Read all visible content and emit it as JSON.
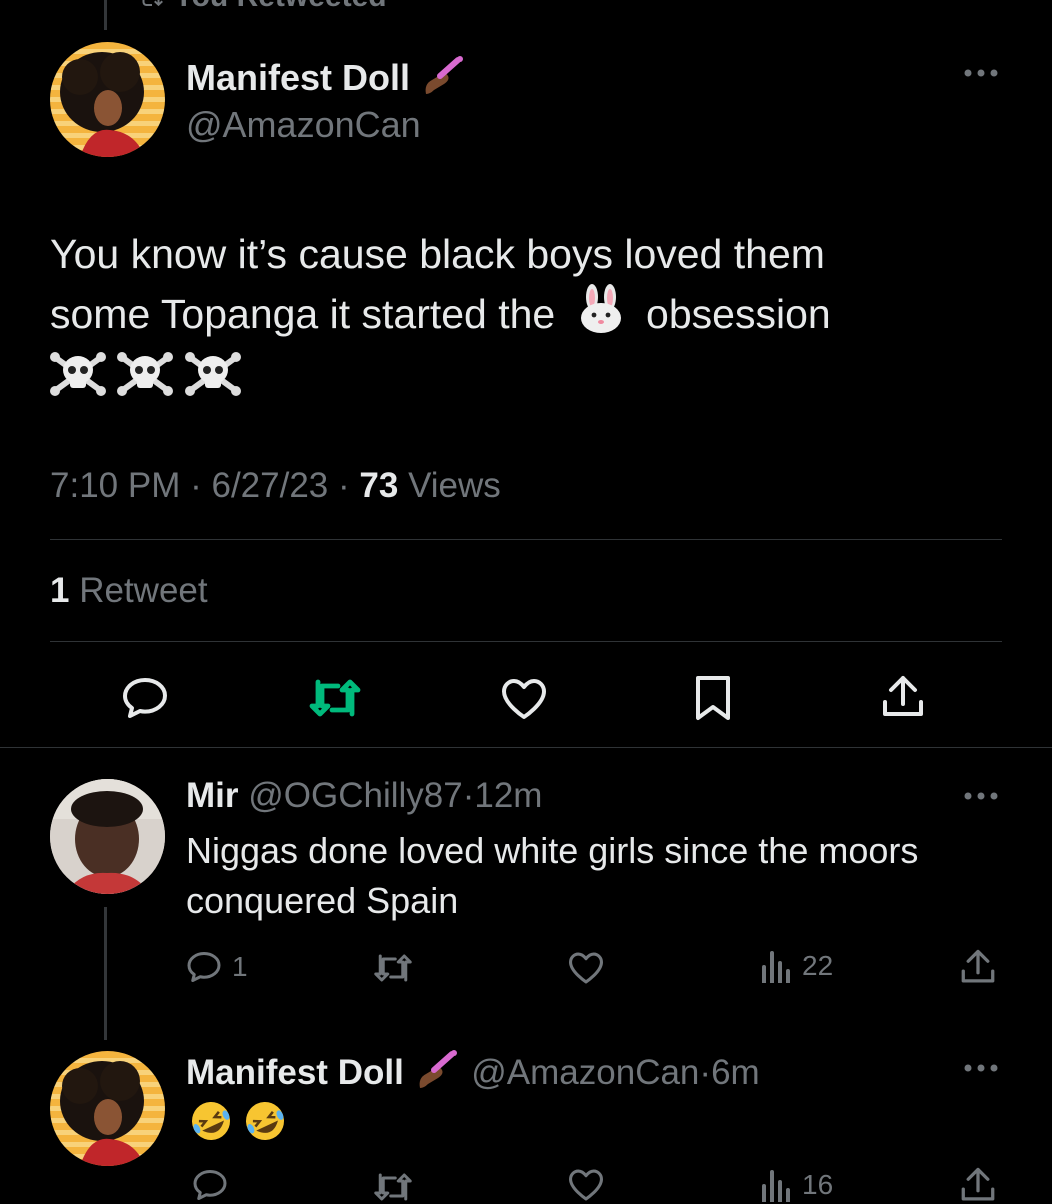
{
  "retweet_banner": {
    "label": "You Retweeted"
  },
  "main_tweet": {
    "author_name": "Manifest Doll",
    "handle": "@AmazonCan",
    "text_line1": "You know it’s cause black boys loved them",
    "text_line2a": "some Topanga it started the",
    "text_line2b": "obsession",
    "time": "7:10 PM",
    "date": "6/27/23",
    "views_count": "73",
    "views_label": "Views",
    "retweet_count": "1",
    "retweet_label": "Retweet"
  },
  "reply1": {
    "author_name": "Mir",
    "handle": "@OGChilly87",
    "age": "12m",
    "text_line1": "Niggas done loved white girls since the moors",
    "text_line2": "conquered Spain",
    "reply_count": "1",
    "views_count": "22"
  },
  "reply2": {
    "author_name": "Manifest Doll",
    "handle": "@AmazonCan",
    "age": "6m",
    "views_count": "16"
  },
  "colors": {
    "background": "#000000",
    "text": "#e7e9ea",
    "muted": "#71767b",
    "divider": "#2f3336",
    "retweet_active": "#00ba7c"
  }
}
